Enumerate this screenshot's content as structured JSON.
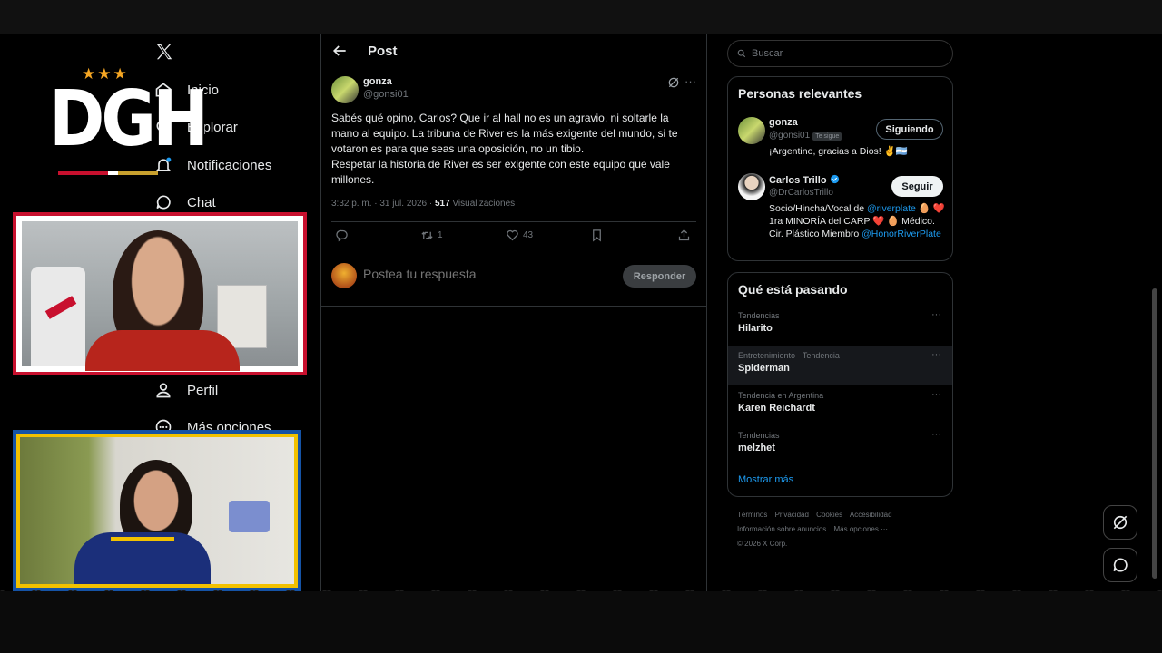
{
  "nav": {
    "items": [
      {
        "label": "Inicio",
        "icon": "home-icon"
      },
      {
        "label": "Explorar",
        "icon": "search-icon"
      },
      {
        "label": "Notificaciones",
        "icon": "bell-icon"
      },
      {
        "label": "Chat",
        "icon": "chat-icon"
      },
      {
        "label": "Perfil",
        "icon": "person-icon"
      },
      {
        "label": "Más opciones",
        "icon": "more-circle-icon"
      }
    ]
  },
  "header": {
    "title": "Post"
  },
  "post": {
    "author_name": "gonza",
    "author_handle": "@gonsi01",
    "text": [
      "Sabés qué opino, Carlos? Que ir al hall no es un agravio, ni soltarle la",
      "mano al equipo. La tribuna de River es la más exigente del mundo, si te",
      "votaron es para que seas una oposición, no un tibio.",
      "Respetar la historia de River es ser exigente con este equipo que vale",
      "millones."
    ],
    "meta_time": "3:32 p. m. · 31 jul. 2026 · ",
    "meta_views": "517",
    "meta_views_label": " Visualizaciones",
    "retweets": "1",
    "likes": "43",
    "reply_placeholder": "Postea tu respuesta",
    "reply_button": "Responder"
  },
  "search": {
    "placeholder": "Buscar"
  },
  "relevant": {
    "title": "Personas relevantes",
    "people": [
      {
        "name": "gonza",
        "handle": "@gonsi01",
        "badge": "Te sigue",
        "bio": "¡Argentino, gracias a Dios! ✌️🇦🇷",
        "button": "Siguiendo"
      },
      {
        "name": "Carlos Trillo",
        "handle": "@DrCarlosTrillo",
        "bio_pre": "Socio/Hincha/Vocal de ",
        "bio_link": "@riverplate",
        "bio_mid": " 🥚 ❤️ 1ra MINORÍA del CARP ❤️ 🥚 Médico. Cir. Plástico Miembro ",
        "bio_link2": "@HonorRiverPlate",
        "button": "Seguir"
      }
    ]
  },
  "trends": {
    "title": "Qué está pasando",
    "items": [
      {
        "category": "Tendencias",
        "name": "Hilarito"
      },
      {
        "category": "Entretenimiento · Tendencia",
        "name": "Spiderman"
      },
      {
        "category": "Tendencia en Argentina",
        "name": "Karen Reichardt"
      },
      {
        "category": "Tendencias",
        "name": "melzhet"
      }
    ],
    "show_more": "Mostrar más"
  },
  "footer": {
    "links": [
      "Términos",
      "Privacidad",
      "Cookies",
      "Accesibilidad",
      "Información sobre anuncios",
      "Más opciones ···"
    ],
    "copyright": "© 2026 X Corp."
  },
  "overlay": {
    "logo_text": "DGH",
    "stars": "★★★"
  },
  "colors": {
    "accent": "#1d9bf0",
    "river_red": "#c8102e",
    "boca_blue": "#1553a6",
    "boca_gold": "#f2c100"
  }
}
